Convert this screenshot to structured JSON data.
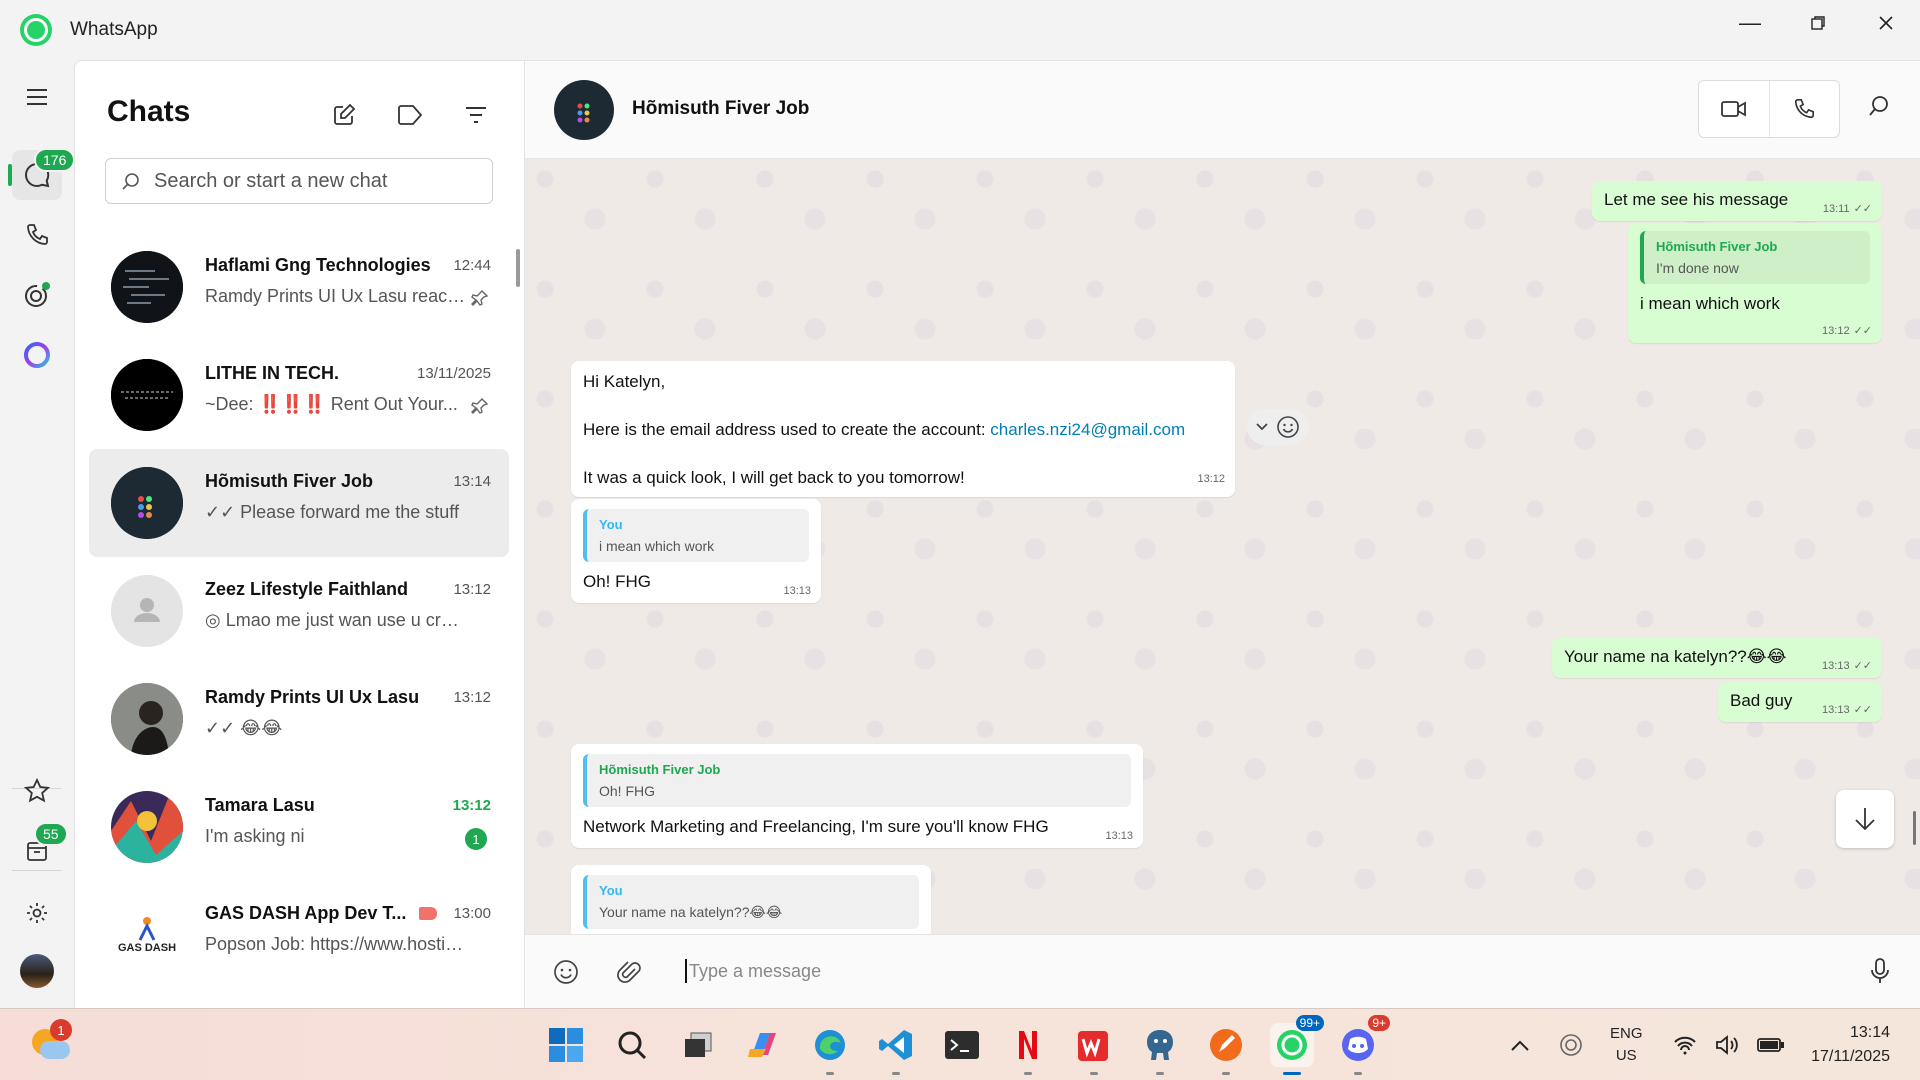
{
  "window": {
    "title": "WhatsApp",
    "controls": [
      "minimize",
      "restore",
      "close"
    ]
  },
  "rail": {
    "chats_badge": "176",
    "archive_badge": "55",
    "icons": [
      "menu-icon",
      "chats-icon",
      "calls-icon",
      "status-icon",
      "meta-ai-icon",
      "starred-icon",
      "archived-icon",
      "settings-icon",
      "profile-avatar"
    ]
  },
  "chatlist": {
    "title": "Chats",
    "search_placeholder": "Search or start a new chat",
    "rows": [
      {
        "name": "Haflami Gng Technologies",
        "time": "12:44",
        "preview": "Ramdy Prints UI Ux Lasu react...",
        "pinned": true
      },
      {
        "name": "LITHE IN TECH.",
        "time": "13/11/2025",
        "preview": "~Dee: ‼️‼️‼️ Rent Out Your...",
        "pinned": true
      },
      {
        "name": "Hõmisuth Fiver Job",
        "time": "13:14",
        "preview": "✓✓ Please forward me the stuff",
        "selected": true
      },
      {
        "name": "Zeez Lifestyle Faithland",
        "time": "13:12",
        "preview": "◎ Lmao me just wan use u crui..."
      },
      {
        "name": "Ramdy Prints UI Ux Lasu",
        "time": "13:12",
        "preview": "✓✓ 😂😂"
      },
      {
        "name": "Tamara Lasu",
        "time": "13:12",
        "preview": "I'm asking ni",
        "unread": "1"
      },
      {
        "name": "GAS DASH App Dev T...",
        "time": "13:00",
        "preview": "Popson Job: https://www.hostin..."
      }
    ],
    "gasdash_logo_text": "GAS DASH"
  },
  "conversation": {
    "name": "Hõmisuth Fiver Job",
    "composer_placeholder": "Type a message",
    "messages": {
      "m1": {
        "text": "Let me see his message",
        "time": "13:11"
      },
      "m2": {
        "quote_author": "Hõmisuth Fiver Job",
        "quote_text": "I'm done now",
        "text": "i mean which work",
        "time": "13:12"
      },
      "m3": {
        "line1": "Hi Katelyn,",
        "line2_prefix": "Here is the email address used to create the account: ",
        "email": "charles.nzi24@gmail.com",
        "line3": "It was a quick look, I will get back to you tomorrow!",
        "time": "13:12"
      },
      "m4": {
        "quote_author": "You",
        "quote_text": "i mean which work",
        "text": "Oh! FHG",
        "time": "13:13"
      },
      "m5": {
        "text": "Your name na katelyn??😂😂",
        "time": "13:13"
      },
      "m6": {
        "text": "Bad guy",
        "time": "13:13"
      },
      "m7": {
        "quote_author": "Hõmisuth Fiver Job",
        "quote_text": "Oh! FHG",
        "text": "Network Marketing and Freelancing, I'm sure you'll know FHG",
        "time": "13:13"
      },
      "m8": {
        "quote_author": "You",
        "quote_text": "Your name na katelyn??😂😂"
      }
    }
  },
  "taskbar": {
    "weather_badge": "1",
    "whatsapp_badge": "99+",
    "discord_badge": "9+",
    "lang1": "ENG",
    "lang2": "US",
    "time": "13:14",
    "date": "17/11/2025"
  }
}
